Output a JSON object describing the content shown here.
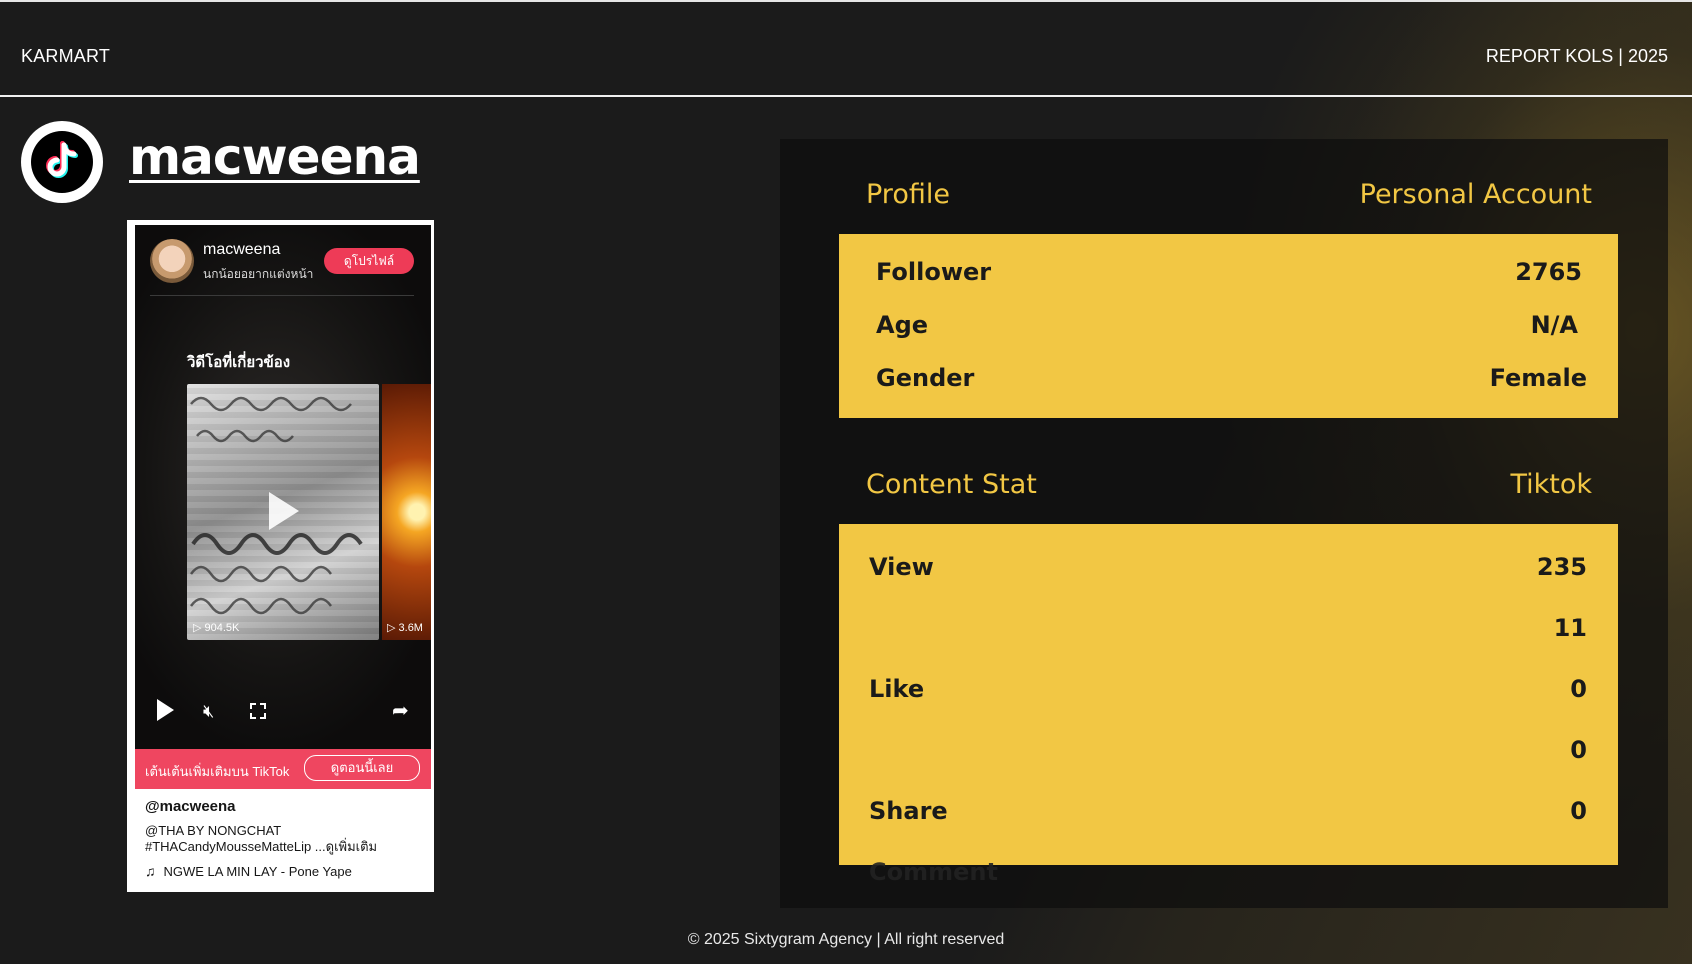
{
  "header": {
    "brand": "KARMART",
    "report": "REPORT KOLS | 2025"
  },
  "creator": {
    "platform_icon": "tiktok-icon",
    "username": "macweena"
  },
  "embed": {
    "name": "macweena",
    "subtitle": "นกน้อยอยากแต่งหน้า",
    "profile_button": "ดูโปรไฟล์",
    "related_heading": "วิดีโอที่เกี่ยวข้อง",
    "related_videos": [
      {
        "views": "904.5K"
      },
      {
        "views": "3.6M"
      }
    ],
    "cta_text": "เต้นเต้นเพิ่มเติมบน TikTok",
    "cta_button": "ดูตอนนี้เลย",
    "handle": "@macweena",
    "description": "@THA BY NONGCHAT #THACandyMousseMatteLip ...ดูเพิ่มเติม",
    "music": "NGWE LA MIN LAY - Pone Yape"
  },
  "profile": {
    "title": "Profile",
    "type": "Personal Account",
    "rows": [
      {
        "label": "Follower",
        "value": "2765"
      },
      {
        "label": "Age",
        "value": "N/A"
      },
      {
        "label": "Gender",
        "value": "Female"
      }
    ]
  },
  "content_stat": {
    "title": "Content Stat",
    "platform": "Tiktok",
    "rows": [
      {
        "label": "View",
        "value": "235"
      },
      {
        "label": "",
        "value": "11"
      },
      {
        "label": "Like",
        "value": "0"
      },
      {
        "label": "",
        "value": "0"
      },
      {
        "label": "Share",
        "value": "0"
      }
    ],
    "overflow_label": "Comment"
  },
  "footer": "© 2025 Sixtygram Agency | All right reserved",
  "colors": {
    "accent": "#f2c744",
    "background": "#1b1b1b",
    "tiktok_red": "#ef4660"
  }
}
